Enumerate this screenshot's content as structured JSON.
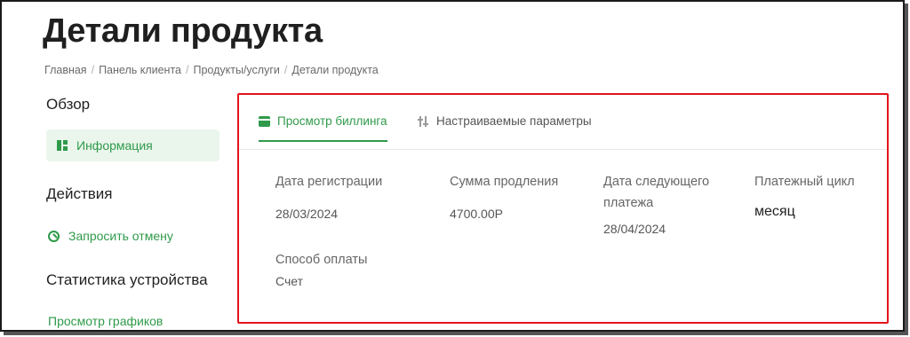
{
  "page": {
    "title": "Детали продукта",
    "breadcrumb": [
      "Главная",
      "Панель клиента",
      "Продукты/услуги",
      "Детали продукта"
    ]
  },
  "sidebar": {
    "overview_heading": "Обзор",
    "info_item": "Информация",
    "actions_heading": "Действия",
    "cancel_link": "Запросить отмену",
    "stats_heading": "Статистика устройства",
    "charts_link": "Просмотр графиков"
  },
  "tabs": {
    "billing": "Просмотр биллинга",
    "settings": "Настраиваемые параметры"
  },
  "billing": {
    "reg_date_label": "Дата регистрации",
    "reg_date_value": "28/03/2024",
    "renewal_label": "Сумма продления",
    "renewal_value": "4700.00Р",
    "next_payment_label_1": "Дата следующего",
    "next_payment_label_2": "платежа",
    "next_payment_value": "28/04/2024",
    "cycle_label": "Платежный цикл",
    "cycle_value": "месяц",
    "payment_method_label": "Способ оплаты",
    "payment_method_value": "Счет"
  },
  "colors": {
    "accent": "#2f9a4a",
    "highlight_border": "#e2141c"
  }
}
